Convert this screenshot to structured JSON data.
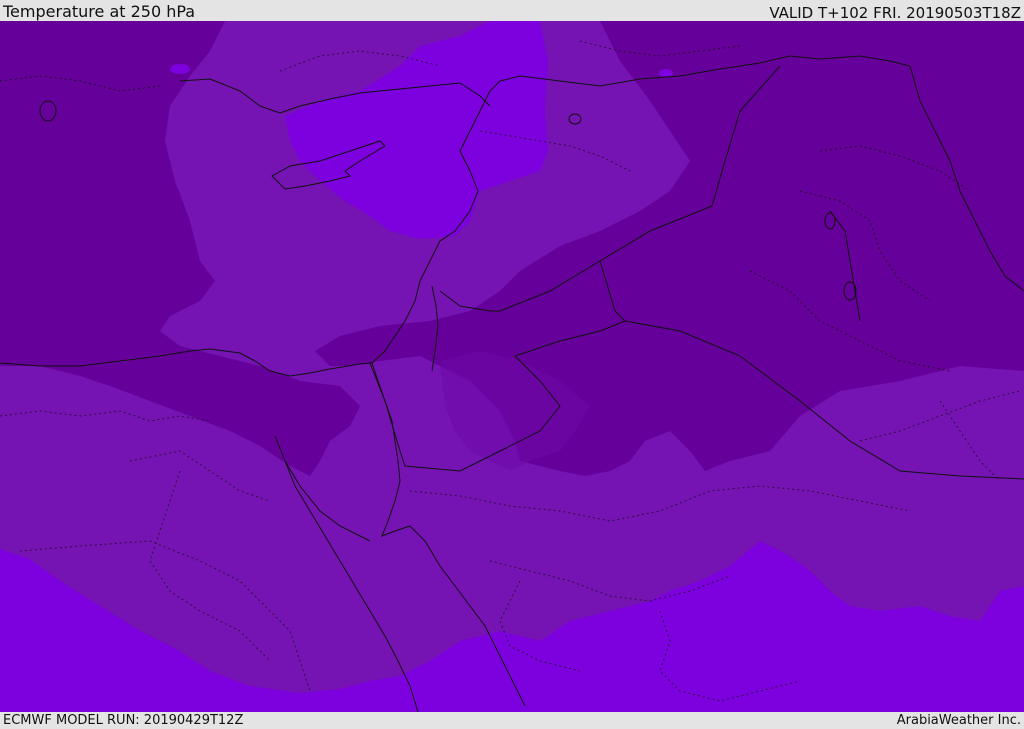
{
  "header": {
    "title": "Temperature at 250 hPa",
    "valid": "VALID T+102 FRI. 20190503T18Z"
  },
  "footer": {
    "model_run": "ECMWF MODEL RUN: 20190429T12Z",
    "credit": "ArabiaWeather Inc."
  },
  "map": {
    "variable": "temperature",
    "level": "250 hPa",
    "shading_colors": {
      "darkest": "#66009a",
      "dark": "#7613b3",
      "medium": "#7a17b9",
      "bright": "#7d00de",
      "brightest": "#7f00e8"
    },
    "boundary_color": "#111111"
  }
}
